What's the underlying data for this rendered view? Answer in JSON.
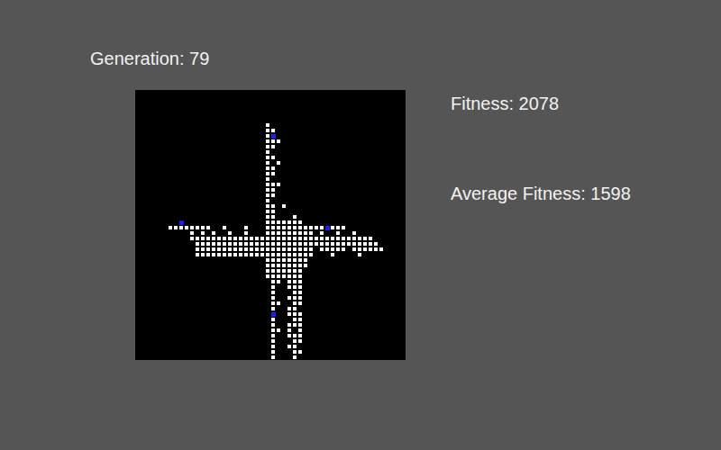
{
  "generation": "Generation: 79",
  "fitness": "Fitness: 2078",
  "average_fitness": "Average Fitness: 1598",
  "grid": {
    "rows": [
      "..................................................",
      "..................................................",
      "..................................................",
      "..................................................",
      "..................................................",
      "..................................................",
      "........................#.........................",
      "........................##........................",
      "........................#B........................",
      "........................###.......................",
      "........................##........................",
      "........................#.........................",
      "........................##........................",
      "........................#.#.......................",
      "........................##........................",
      "........................##........................",
      "........................#.........................",
      "........................###.......................",
      "........................##........................",
      "........................##........................",
      "........................#.........................",
      "........................##.#......................",
      "........................##........................",
      "........................##...#....................",
      "........B...............#######...................",
      "......########..#...#...###########B###.....",
      "..........#.#.#..#..#...#########.#..#..#.........",
      "..........##################################......",
      "...........##################################.....",
      "...........######################.#####.######....",
      "...........######################...#....#........",
      "........................########..................",
      "........................########..................",
      "........................#######...................",
      "........................#######...................",
      ".........................##.###...................",
      ".........................#..###...................",
      ".........................#...##...................",
      ".........................#..###...................",
      ".........................##..##...................",
      ".........................#..##....................",
      ".........................B..###...................",
      ".........................#...##...................",
      ".........................#..###...................",
      ".........................##.#.#...................",
      ".........................#..###...................",
      ".........................#...##...................",
      ".........................#..##....................",
      ".........................#...##...................",
      ".........................#...#...................."
    ]
  }
}
